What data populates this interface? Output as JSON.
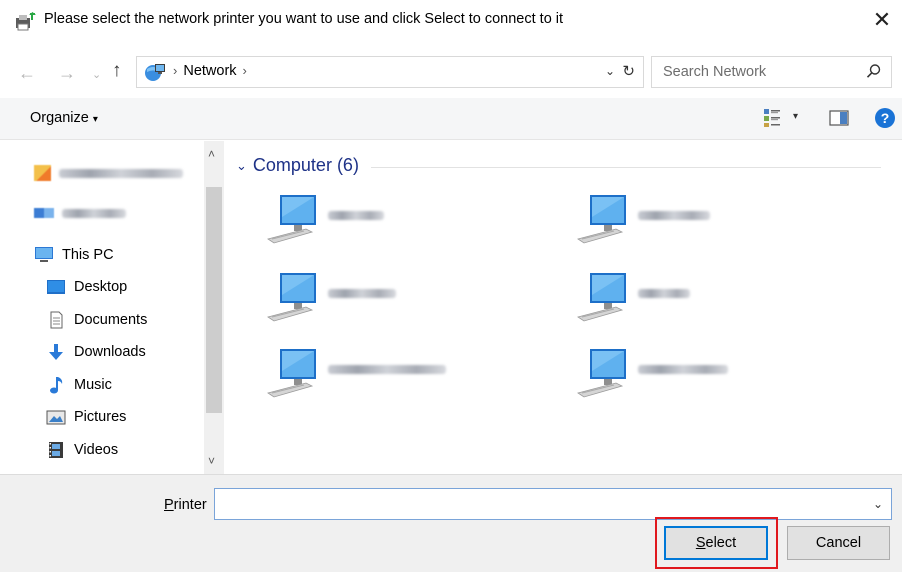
{
  "window": {
    "title": "Please select the network printer you want to use and click Select to connect to it",
    "close_glyph": "✕"
  },
  "address_bar": {
    "back_glyph": "←",
    "forward_glyph": "→",
    "recent_glyph": "⌄",
    "up_glyph": "↑",
    "breadcrumb": "Network",
    "crumb_sep": "›",
    "dropdown_glyph": "⌄",
    "refresh_glyph": "↻",
    "search_placeholder": "Search Network"
  },
  "command_bar": {
    "organize_label": "Organize",
    "organize_caret": "▾",
    "view_caret": "▾",
    "help_glyph": "?"
  },
  "nav_pane": {
    "items": [
      {
        "label": "This PC",
        "icon": "this-pc-icon"
      },
      {
        "label": "Desktop",
        "icon": "desktop-folder-icon"
      },
      {
        "label": "Documents",
        "icon": "documents-icon"
      },
      {
        "label": "Downloads",
        "icon": "downloads-icon"
      },
      {
        "label": "Music",
        "icon": "music-icon"
      },
      {
        "label": "Pictures",
        "icon": "pictures-icon"
      },
      {
        "label": "Videos",
        "icon": "videos-icon"
      }
    ],
    "scroll_up_glyph": "˄",
    "scroll_down_glyph": "˅"
  },
  "content": {
    "group_title": "Computer (6)",
    "group_chevron": "⌄",
    "computers_count": 6
  },
  "bottom": {
    "printer_label_first": "P",
    "printer_label_rest": "rinter",
    "printer_value": "",
    "dropdown_glyph": "⌄",
    "select_first": "S",
    "select_rest": "elect",
    "cancel_label": "Cancel"
  },
  "colors": {
    "accent": "#0078d7",
    "highlight_box": "#e0181e",
    "group_header": "#1e3287"
  }
}
